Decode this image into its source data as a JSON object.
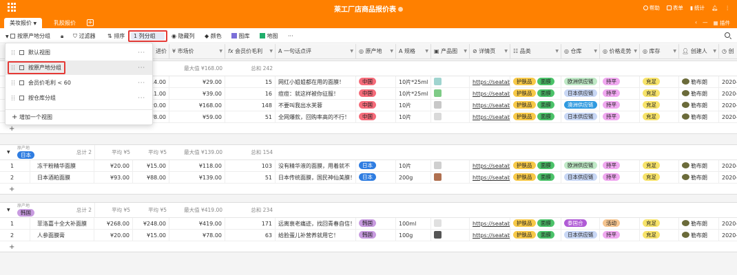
{
  "app": {
    "title": "莱工厂店商品报价表",
    "right_items": [
      "帮助",
      "表单",
      "统计"
    ],
    "share_label": "插件"
  },
  "tabs": [
    {
      "label": "美妆报价",
      "active": true
    },
    {
      "label": "乳胶报价",
      "active": false
    }
  ],
  "toolbar": {
    "view_name": "按原产地分组",
    "filter": "过滤器",
    "sort": "排序",
    "group": "1 列分组",
    "hide": "隐藏列",
    "color": "颜色",
    "gallery": "图库",
    "map": "地图",
    "more": "···"
  },
  "columns": [
    "进价",
    "市场价",
    "会员价毛利",
    "一句话点评",
    "原产地",
    "规格",
    "产品图",
    "详情页",
    "品类",
    "仓库",
    "价格走势",
    "库存",
    "创建人",
    "创"
  ],
  "views_popup": {
    "items": [
      "默认视图",
      "按原产地分组",
      "会员价毛利 < 60",
      "按仓库分组"
    ],
    "add_label": "增加一个视图"
  },
  "groups": [
    {
      "label": "",
      "tag_color": "#ffffff",
      "summary": {
        "count": "",
        "avg_sale": "¥1",
        "avg_cost": "",
        "max_market": "最大值 ¥168.00",
        "sum_margin": "总和 242"
      },
      "rows": [
        {
          "no": "",
          "name": "",
          "sale": "",
          "cost": "¥14.00",
          "market": "¥29.00",
          "margin": "15",
          "comment": "网红小姐姐都在用的面膜！",
          "origin": "中国",
          "spec": "10片*25ml",
          "url": "https://seatab",
          "cat": "护肤品",
          "sub": "面膜",
          "wh": "欧洲供应链",
          "trend": "持平",
          "stock": "充足",
          "creator": "勒布朗",
          "date": "2020-"
        },
        {
          "no": "",
          "name": "",
          "sale": "",
          "cost": "¥11.00",
          "market": "¥39.00",
          "margin": "16",
          "comment": "痘痘：就这样被你征服！",
          "origin": "中国",
          "spec": "10片*25ml",
          "url": "https://seatab",
          "cat": "护肤品",
          "sub": "面膜",
          "wh": "日本供应链",
          "trend": "持平",
          "stock": "充足",
          "creator": "勒布朗",
          "date": "2020-"
        },
        {
          "no": "",
          "name": "",
          "sale": "",
          "cost": "¥20.00",
          "market": "¥168.00",
          "margin": "148",
          "comment": "不要叫我出水芙蓉",
          "origin": "中国",
          "spec": "10片",
          "url": "https://seatab",
          "cat": "护肤品",
          "sub": "面膜",
          "wh": "澳洲供应链",
          "trend": "持平",
          "stock": "充足",
          "creator": "勒布朗",
          "date": "2020-"
        },
        {
          "no": "",
          "name": "",
          "sale": "",
          "cost": "¥8.00",
          "market": "¥59.00",
          "margin": "51",
          "comment": "全网爆款，回购率高的不行！",
          "origin": "中国",
          "spec": "10片",
          "url": "https://seatab",
          "cat": "护肤品",
          "sub": "面膜",
          "wh": "日本供应链",
          "trend": "持平",
          "stock": "充足",
          "creator": "勒布朗",
          "date": "2020-"
        }
      ]
    },
    {
      "label": "日本",
      "caption": "原产地",
      "tag_color": "#2f7de1",
      "summary": {
        "count": "总计 2",
        "avg_sale": "平均 ¥5",
        "avg_cost": "平均 ¥5",
        "max_market": "最大值 ¥139.00",
        "sum_margin": "总和 154"
      },
      "rows": [
        {
          "no": "1",
          "name": "冻干粉精华面膜",
          "sale": "¥20.00",
          "cost": "¥15.00",
          "market": "¥118.00",
          "margin": "103",
          "comment": "没有精华液的面膜，用着就不",
          "origin": "日本",
          "spec": "10片",
          "url": "https://seatab",
          "cat": "护肤品",
          "sub": "面膜",
          "wh": "欧洲供应链",
          "trend": "持平",
          "stock": "充足",
          "creator": "勒布朗",
          "date": "2020-"
        },
        {
          "no": "2",
          "name": "日本酒粕面膜",
          "sale": "¥93.00",
          "cost": "¥88.00",
          "market": "¥139.00",
          "margin": "51",
          "comment": "日本传统面膜，国民神仙美膜！",
          "origin": "日本",
          "spec": "200g",
          "url": "https://seatab",
          "cat": "护肤品",
          "sub": "面膜",
          "wh": "日本供应链",
          "trend": "持平",
          "stock": "充足",
          "creator": "勒布朗",
          "date": "2020-"
        }
      ]
    },
    {
      "label": "韩国",
      "caption": "原产地",
      "tag_color": "#c89be0",
      "summary": {
        "count": "总计 2",
        "avg_sale": "平均 ¥5",
        "avg_cost": "平均 ¥5",
        "max_market": "最大值 ¥419.00",
        "sum_margin": "总和 234"
      },
      "rows": [
        {
          "no": "1",
          "name": "菲洛嘉十全大补面膜",
          "sale": "¥268.00",
          "cost": "¥248.00",
          "market": "¥419.00",
          "margin": "171",
          "comment": "远离衰老痛迹，找回青春自信！",
          "origin": "韩国",
          "spec": "100ml",
          "url": "https://seatab",
          "cat": "护肤品",
          "sub": "面膜",
          "wh": "泰国合",
          "trend": "活动",
          "stock": "充足",
          "creator": "勒布朗",
          "date": "2020-"
        },
        {
          "no": "2",
          "name": "人参面膜膏",
          "sale": "¥20.00",
          "cost": "¥15.00",
          "market": "¥78.00",
          "margin": "63",
          "comment": "给脸蛋儿补营养就用它！",
          "origin": "韩国",
          "spec": "100g",
          "url": "https://seatab",
          "cat": "护肤品",
          "sub": "面膜",
          "wh": "日本供应链",
          "trend": "持平",
          "stock": "充足",
          "creator": "勒布朗",
          "date": "2020-"
        }
      ]
    }
  ],
  "colors": {
    "brand": "#ff8000",
    "origin_china": "#f56c7a",
    "origin_japan": "#2f7de1",
    "origin_korea": "#c89be0",
    "cat_skincare": "#f7c948",
    "sub_mask": "#4cc36a",
    "wh_europe": "#bfe9c6",
    "wh_japan": "#c8d7f5",
    "wh_australia": "#2f9ae0",
    "wh_thailand": "#b05bd6",
    "trend_flat": "#f0a8f0",
    "trend_promo": "#f5c590",
    "stock_ok": "#f7e36a"
  }
}
